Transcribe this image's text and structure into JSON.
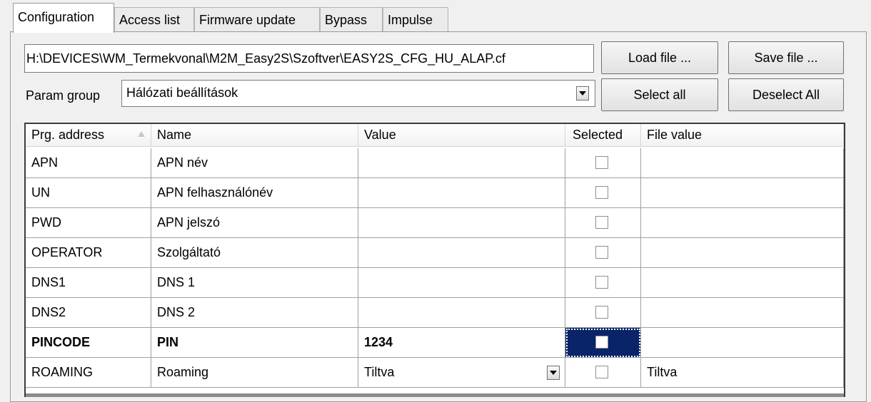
{
  "tabs": [
    "Configuration",
    "Access list",
    "Firmware update",
    "Bypass",
    "Impulse"
  ],
  "file_path": "H:\\DEVICES\\WM_Termekvonal\\M2M_Easy2S\\Szoftver\\EASY2S_CFG_HU_ALAP.cf",
  "buttons": {
    "load": "Load file ...",
    "save": "Save file ...",
    "select_all": "Select all",
    "deselect_all": "Deselect All"
  },
  "param_group": {
    "label": "Param group",
    "value": "Hálózati beállítások"
  },
  "grid": {
    "headers": [
      "Prg. address",
      "Name",
      "Value",
      "Selected",
      "File value"
    ],
    "rows": [
      {
        "address": "APN",
        "name": "APN név",
        "value": "",
        "selected": false,
        "file_value": ""
      },
      {
        "address": "UN",
        "name": "APN felhasználónév",
        "value": "",
        "selected": false,
        "file_value": ""
      },
      {
        "address": "PWD",
        "name": "APN jelszó",
        "value": "",
        "selected": false,
        "file_value": ""
      },
      {
        "address": "OPERATOR",
        "name": "Szolgáltató",
        "value": "",
        "selected": false,
        "file_value": ""
      },
      {
        "address": "DNS1",
        "name": "DNS 1",
        "value": "",
        "selected": false,
        "file_value": ""
      },
      {
        "address": "DNS2",
        "name": "DNS 2",
        "value": "",
        "selected": false,
        "file_value": ""
      },
      {
        "address": "PINCODE",
        "name": "PIN",
        "value": "1234",
        "selected": false,
        "file_value": ""
      },
      {
        "address": "ROAMING",
        "name": "Roaming",
        "value": "Tiltva",
        "selected": false,
        "file_value": "Tiltva"
      }
    ]
  },
  "colors": {
    "selection": "#0a246a",
    "window_bg": "#f0f0f0"
  }
}
